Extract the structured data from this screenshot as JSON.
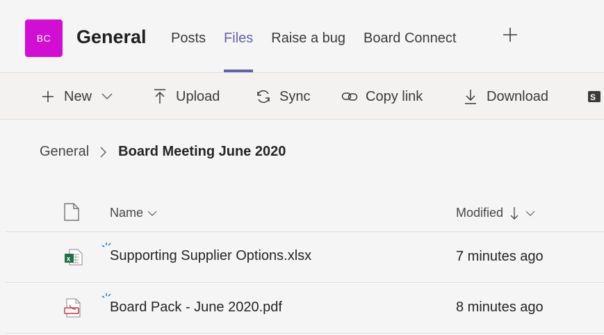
{
  "team": {
    "initials": "BC",
    "channel": "General"
  },
  "tabs": [
    {
      "label": "Posts",
      "active": false
    },
    {
      "label": "Files",
      "active": true
    },
    {
      "label": "Raise a bug",
      "active": false
    },
    {
      "label": "Board Connect",
      "active": false
    }
  ],
  "toolbar": {
    "new_label": "New",
    "upload_label": "Upload",
    "sync_label": "Sync",
    "copy_link_label": "Copy link",
    "download_label": "Download"
  },
  "breadcrumb": {
    "root": "General",
    "current": "Board Meeting June 2020"
  },
  "table": {
    "col_name": "Name",
    "col_modified": "Modified",
    "rows": [
      {
        "name": "Supporting Supplier Options.xlsx",
        "modified": "7 minutes ago",
        "icon": "excel-icon"
      },
      {
        "name": "Board Pack - June 2020.pdf",
        "modified": "8 minutes ago",
        "icon": "pdf-icon"
      }
    ]
  },
  "colors": {
    "accent": "#6264a7",
    "avatar": "#d20ed4",
    "excel": "#1e7145",
    "pdf": "#d13438",
    "new_marker": "#0078d4"
  }
}
